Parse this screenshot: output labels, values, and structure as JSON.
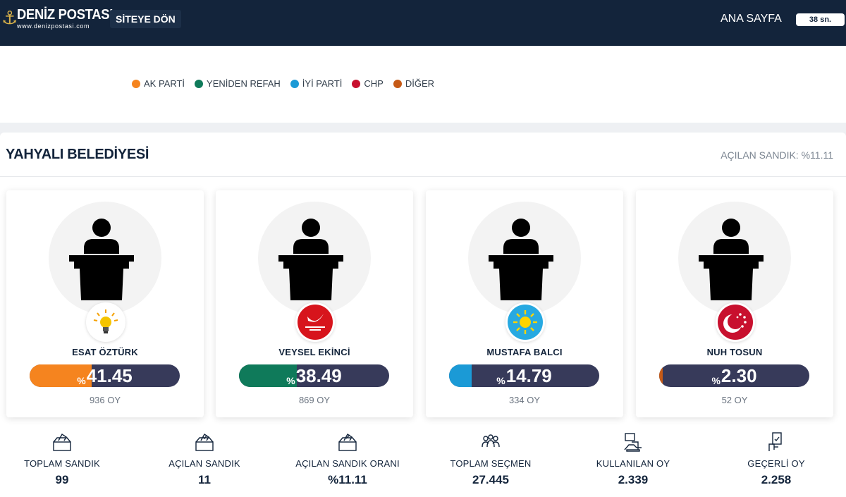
{
  "header": {
    "brand": "DENİZ POSTASI",
    "brand_url": "www.denizpostasi.com",
    "back_button": "SİTEYE DÖN",
    "home_link": "ANA SAYFA",
    "timer": "38 sn."
  },
  "legend": [
    {
      "label": "AK PARTİ",
      "color": "#f5841f"
    },
    {
      "label": "YENİDEN REFAH",
      "color": "#0f7a5a"
    },
    {
      "label": "İYİ PARTİ",
      "color": "#1b9ad6"
    },
    {
      "label": "CHP",
      "color": "#c8102e"
    },
    {
      "label": "DİĞER",
      "color": "#c65a16"
    }
  ],
  "panel": {
    "title": "YAHYALI BELEDİYESİ",
    "opened_box_label": "AÇILAN SANDIK: %11.11"
  },
  "candidates": [
    {
      "name": "ESAT ÖZTÜRK",
      "party_icon": "ak-parti-bulb-icon",
      "color": "#f5841f",
      "percent_value": 41.45,
      "percent_symbol": "%",
      "percent_text": "41.45",
      "votes": "936 OY"
    },
    {
      "name": "VEYSEL EKİNCİ",
      "party_icon": "yeniden-refah-icon",
      "color": "#0f7a5a",
      "percent_value": 38.49,
      "percent_symbol": "%",
      "percent_text": "38.49",
      "votes": "869 OY"
    },
    {
      "name": "MUSTAFA BALCI",
      "party_icon": "iyi-parti-sun-icon",
      "color": "#1b9ad6",
      "percent_value": 14.79,
      "percent_symbol": "%",
      "percent_text": "14.79",
      "votes": "334 OY"
    },
    {
      "name": "NUH TOSUN",
      "party_icon": "crescent-stars-icon",
      "color": "#c65a16",
      "percent_value": 2.3,
      "percent_symbol": "%",
      "percent_text": "2.30",
      "votes": "52 OY"
    }
  ],
  "stats": [
    {
      "label": "TOPLAM SANDIK",
      "value": "99",
      "icon": "ballot-box-icon"
    },
    {
      "label": "AÇILAN SANDIK",
      "value": "11",
      "icon": "ballot-box-check-icon"
    },
    {
      "label": "AÇILAN SANDIK ORANI",
      "value": "%11.11",
      "icon": "ballot-box-percent-icon"
    },
    {
      "label": "TOPLAM SEÇMEN",
      "value": "27.445",
      "icon": "voters-group-icon"
    },
    {
      "label": "KULLANILAN OY",
      "value": "2.339",
      "icon": "hand-vote-icon"
    },
    {
      "label": "GEÇERLİ OY",
      "value": "2.258",
      "icon": "valid-vote-icon"
    }
  ]
}
